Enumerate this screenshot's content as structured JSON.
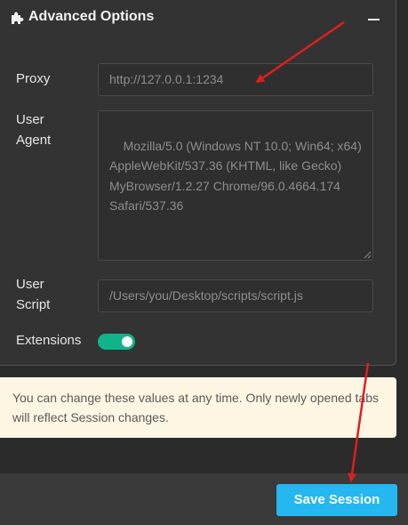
{
  "section": {
    "title": "Advanced Options",
    "icon": "puzzle-icon",
    "collapse_icon": "minus-icon"
  },
  "fields": {
    "proxy": {
      "label": "Proxy",
      "value": "http://127.0.0.1:1234"
    },
    "user_agent": {
      "label": "User Agent",
      "value": "Mozilla/5.0 (Windows NT 10.0; Win64; x64) AppleWebKit/537.36 (KHTML, like Gecko) MyBrowser/1.2.27 Chrome/96.0.4664.174 Safari/537.36"
    },
    "user_script": {
      "label": "User Script",
      "value": "/Users/you/Desktop/scripts/script.js"
    },
    "extensions": {
      "label": "Extensions",
      "enabled": true
    }
  },
  "notice": {
    "text": "You can change these values at any time. Only newly opened tabs will reflect Session changes."
  },
  "footer": {
    "save_label": "Save Session"
  },
  "colors": {
    "toggle_on": "#10b48a",
    "save_button": "#24b7f0",
    "notice_bg": "#fdf6e3",
    "annotation_arrow": "#e01e1e"
  }
}
